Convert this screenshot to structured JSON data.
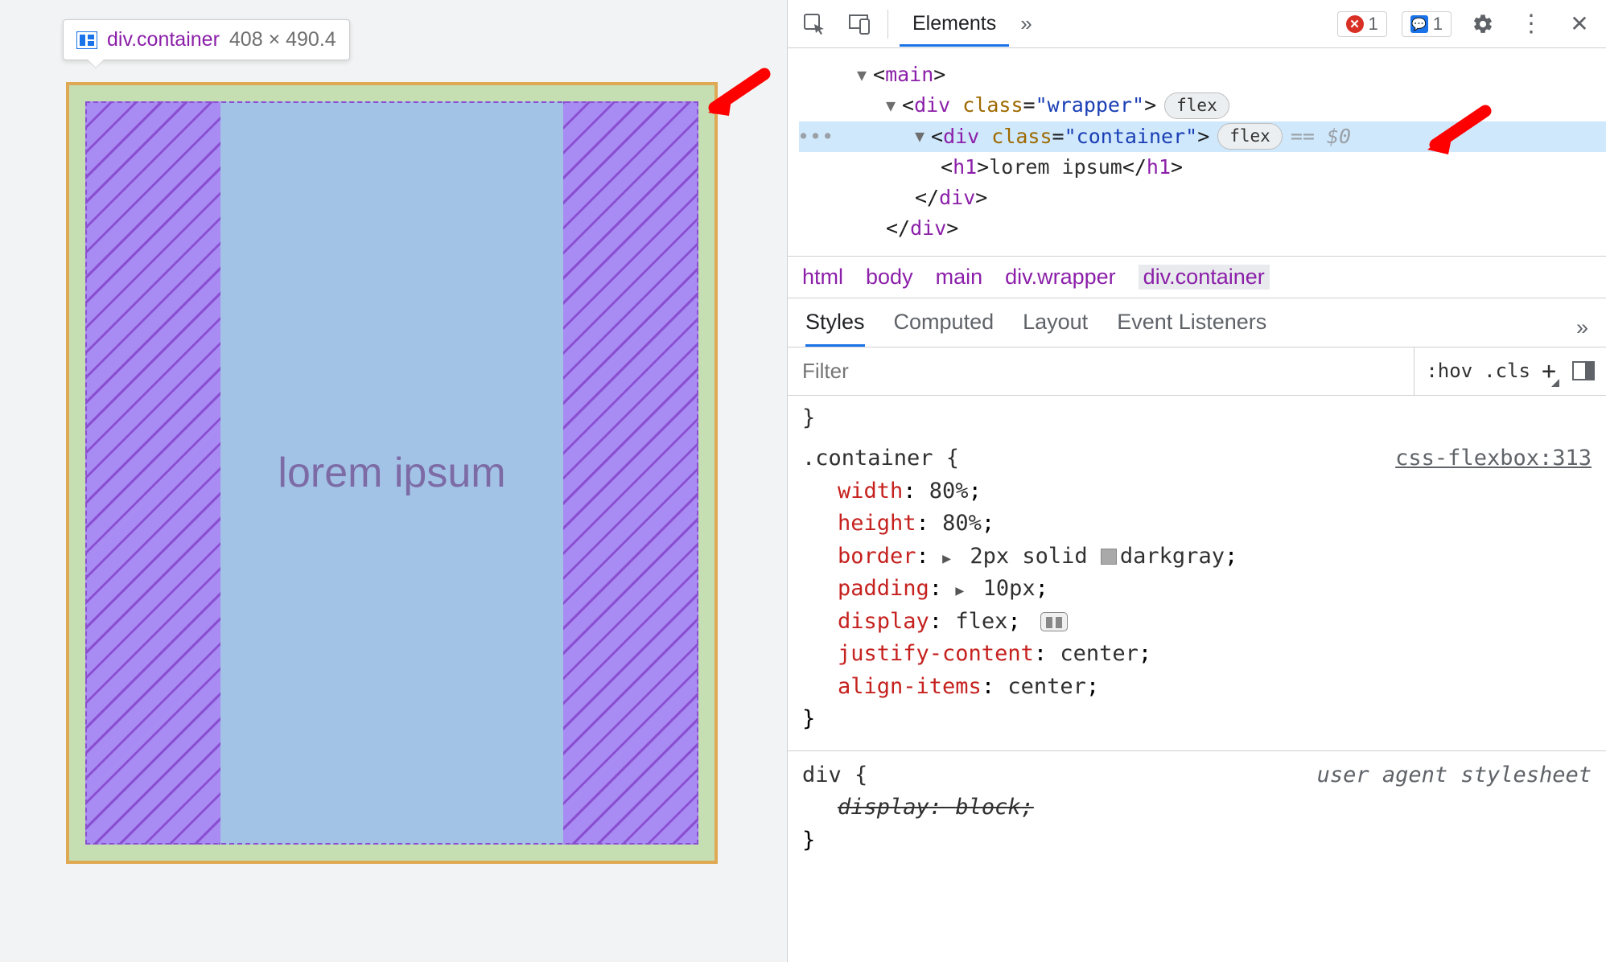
{
  "tooltip": {
    "selector_tag": "div",
    "selector_class": ".container",
    "dimensions": "408 × 490.4"
  },
  "preview": {
    "content_text": "lorem ipsum"
  },
  "toolbar": {
    "tab_elements": "Elements",
    "errors_count": "1",
    "info_count": "1"
  },
  "dom": {
    "line1_open": "<",
    "main_tag": "main",
    "line1_close": ">",
    "div": "div",
    "class_attr": "class",
    "wrapper_val": "\"wrapper\"",
    "container_val": "\"container\"",
    "flex_pill": "flex",
    "eq_dollar": "== $0",
    "h1": "h1",
    "h1_text": "lorem ipsum",
    "close_h1": "</h1>",
    "close_div": "</div>"
  },
  "breadcrumb": {
    "items": [
      "html",
      "body",
      "main",
      "div.wrapper",
      "div.container"
    ]
  },
  "styles_tabs": {
    "t0": "Styles",
    "t1": "Computed",
    "t2": "Layout",
    "t3": "Event Listeners"
  },
  "filter": {
    "placeholder": "Filter",
    "hov": ":hov",
    "cls": ".cls"
  },
  "rules": {
    "container_src": "css-flexbox:313",
    "container_sel": ".container {",
    "decls": {
      "width": {
        "p": "width",
        "v": "80%"
      },
      "height": {
        "p": "height",
        "v": "80%"
      },
      "border": {
        "p": "border",
        "v": "2px solid",
        "color": "darkgray"
      },
      "padding": {
        "p": "padding",
        "v": "10px"
      },
      "display": {
        "p": "display",
        "v": "flex"
      },
      "jc": {
        "p": "justify-content",
        "v": "center"
      },
      "ai": {
        "p": "align-items",
        "v": "center"
      }
    },
    "close": "}",
    "ua_sel": "div {",
    "ua_src": "user agent stylesheet",
    "ua_decl_p": "display",
    "ua_decl_v": "block"
  }
}
